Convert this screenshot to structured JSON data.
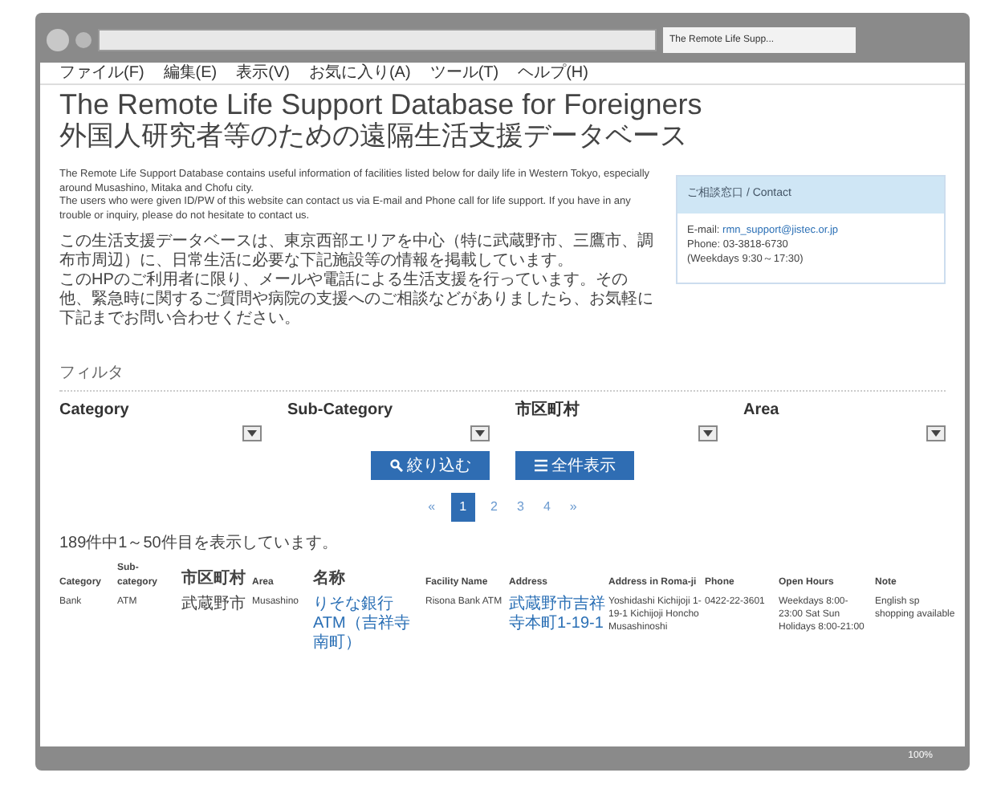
{
  "browser": {
    "tab_title": "The Remote Life Supp...",
    "menu": [
      "ファイル(F)",
      "編集(E)",
      "表示(V)",
      "お気に入り(A)",
      "ツール(T)",
      "ヘルプ(H)"
    ],
    "zoom": "100%"
  },
  "page": {
    "title": "The Remote Life Support Database for Foreigners",
    "subtitle": "外国人研究者等のための遠隔生活支援データベース",
    "intro_en": [
      "The Remote Life Support Database contains useful information of facilities listed below for daily life in Western Tokyo, especially around Musashino, Mitaka and Chofu city.",
      "The users who were given ID/PW of this website can contact us via E-mail and Phone call for life support. If you have in any trouble or inquiry, please do not hesitate to contact us."
    ],
    "intro_ja": [
      "この生活支援データベースは、東京西部エリアを中心（特に武蔵野市、三鷹市、調布市周辺）に、日常生活に必要な下記施設等の情報を掲載しています。",
      "このHPのご利用者に限り、メールや電話による生活支援を行っています。その他、緊急時に関するご質問や病院の支援へのご相談などがありましたら、お気軽に下記までお問い合わせください。"
    ],
    "contact": {
      "heading": "ご相談窓口 / Contact",
      "email_label": "E-mail:",
      "email": "rmn_support@jistec.or.jp",
      "phone": "Phone: 03-3818-6730",
      "hours": "(Weekdays 9:30～17:30)"
    },
    "filter": {
      "heading": "フィルタ",
      "fields": [
        {
          "label": "Category"
        },
        {
          "label": "Sub-Category"
        },
        {
          "label": "市区町村"
        },
        {
          "label": "Area"
        }
      ],
      "buttons": [
        "絞り込む",
        "全件表示"
      ]
    },
    "pagination": [
      {
        "label": "«",
        "selected": false
      },
      {
        "label": "1",
        "selected": true
      },
      {
        "label": "2",
        "selected": false
      },
      {
        "label": "3",
        "selected": false
      },
      {
        "label": "4",
        "selected": false
      },
      {
        "label": "»",
        "selected": false
      }
    ],
    "result_count": "189件中1～50件目を表示しています。",
    "table": {
      "columns": [
        "Category",
        "Sub-category",
        "市区町村",
        "Area",
        "名称",
        "Facility Name",
        "Address",
        "Address in Roma-ji",
        "Phone",
        "Open Hours",
        "Note"
      ],
      "rows": [
        [
          {
            "text": "Bank",
            "link": false
          },
          {
            "text": "ATM",
            "link": false
          },
          {
            "text": "武蔵野市",
            "link": false
          },
          {
            "text": "Musashino",
            "link": false
          },
          {
            "text": "りそな銀行 ATM（吉祥寺南町）",
            "link": true
          },
          {
            "text": "Risona Bank ATM",
            "link": false
          },
          {
            "text": "武蔵野市吉祥寺本町1-19-1",
            "link": true
          },
          {
            "text": "Yoshidashi Kichijoji 1-19-1 Kichijoji Honcho Musashinoshi",
            "link": false
          },
          {
            "text": "0422-22-3601",
            "link": false
          },
          {
            "text": "Weekdays 8:00-23:00 Sat Sun Holidays 8:00-21:00",
            "link": false
          },
          {
            "text": "English sp shopping available",
            "link": false
          }
        ]
      ]
    }
  }
}
